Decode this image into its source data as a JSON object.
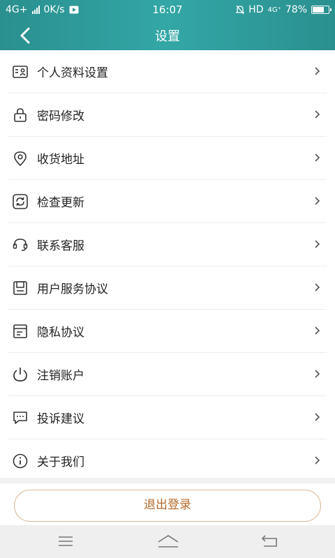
{
  "status_bar": {
    "network": "4G+",
    "speed": "0K/s",
    "time": "16:07",
    "hd": "HD",
    "net2": "4G⁺",
    "battery": "78%",
    "battery_level": 0.78
  },
  "header": {
    "title": "设置"
  },
  "menu": [
    {
      "label": "个人资料设置",
      "icon": "profile-card-icon"
    },
    {
      "label": "密码修改",
      "icon": "lock-icon"
    },
    {
      "label": "收货地址",
      "icon": "location-pin-icon"
    },
    {
      "label": "检查更新",
      "icon": "refresh-icon"
    },
    {
      "label": "联系客服",
      "icon": "headset-icon"
    },
    {
      "label": "用户服务协议",
      "icon": "save-document-icon"
    },
    {
      "label": "隐私协议",
      "icon": "document-icon"
    },
    {
      "label": "注销账户",
      "icon": "power-icon"
    },
    {
      "label": "投诉建议",
      "icon": "chat-bubble-icon"
    },
    {
      "label": "关于我们",
      "icon": "info-icon"
    }
  ],
  "logout_label": "退出登录",
  "colors": {
    "header": "#2f9c9b",
    "logout_text": "#b5692c",
    "logout_border": "#d9b99a"
  }
}
